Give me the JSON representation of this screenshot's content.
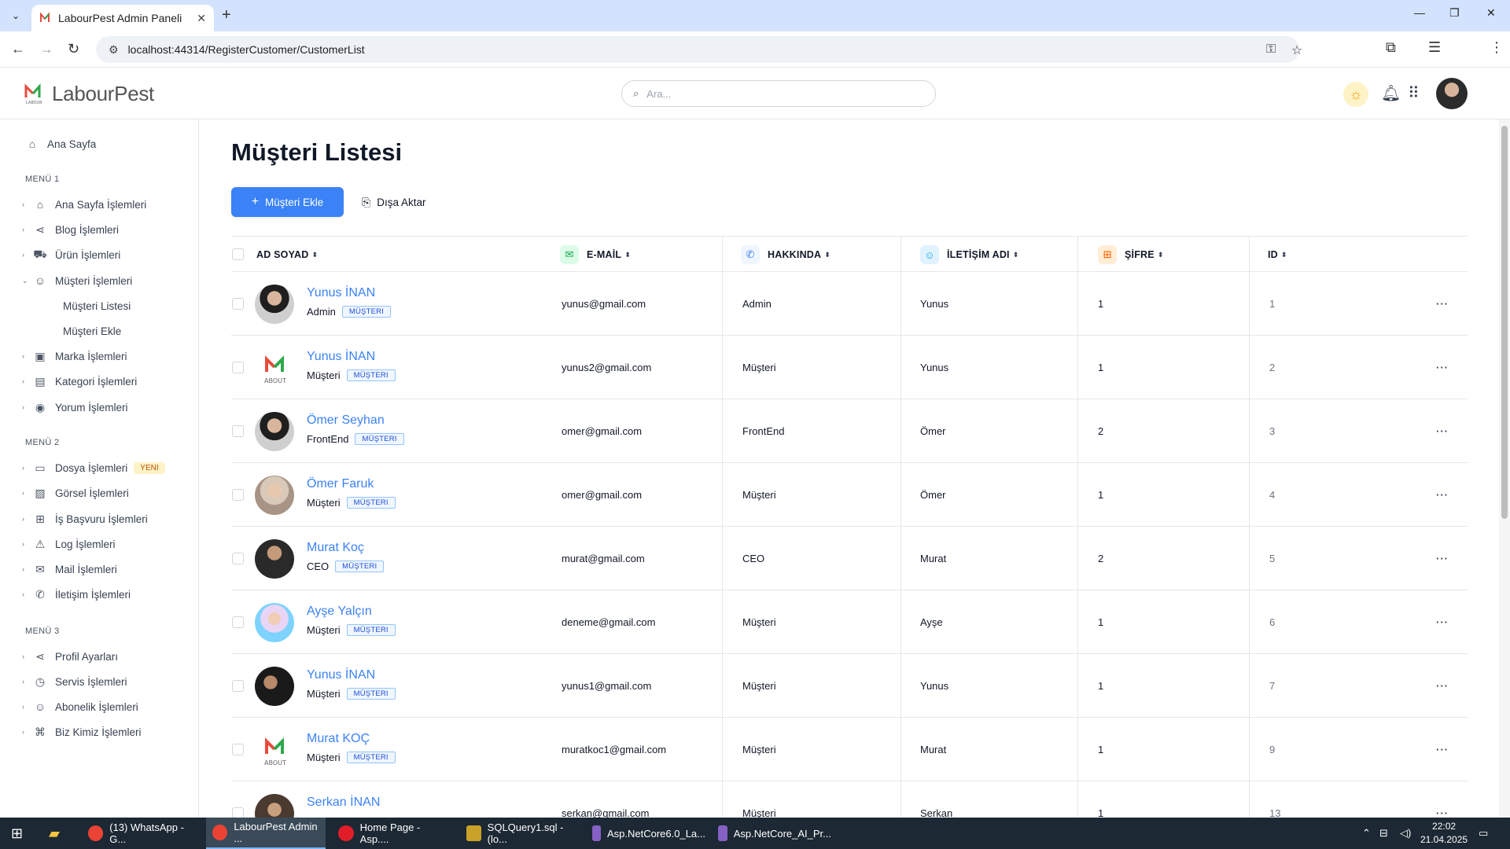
{
  "browser": {
    "tab_title": "LabourPest Admin Paneli",
    "url": "localhost:44314/RegisterCustomer/CustomerList"
  },
  "app": {
    "logo_text": "LabourPest",
    "search_placeholder": "Ara..."
  },
  "sidebar": {
    "home": "Ana Sayfa",
    "menu1_title": "MENÜ 1",
    "menu1": [
      "Ana Sayfa İşlemleri",
      "Blog İşlemleri",
      "Ürün İşlemleri",
      "Müşteri İşlemleri"
    ],
    "menu1_sub": [
      "Müşteri Listesi",
      "Müşteri Ekle"
    ],
    "menu1_rest": [
      "Marka İşlemleri",
      "Kategori İşlemleri",
      "Yorum İşlemleri"
    ],
    "menu2_title": "MENÜ 2",
    "menu2": [
      "Dosya İşlemleri",
      "Görsel İşlemleri",
      "İş Başvuru İşlemleri",
      "Log İşlemleri",
      "Mail İşlemleri",
      "İletişim İşlemleri"
    ],
    "new_badge": "YENI",
    "menu3_title": "MENÜ 3",
    "menu3": [
      "Profil Ayarları",
      "Servis İşlemleri",
      "Abonelik İşlemleri",
      "Biz Kimiz İşlemleri"
    ]
  },
  "main": {
    "title": "Müşteri Listesi",
    "add_button": "Müşteri Ekle",
    "export_button": "Dışa Aktar"
  },
  "table": {
    "headers": [
      "AD SOYAD",
      "E-MAİL",
      "HAKKINDA",
      "İLETİŞİM ADI",
      "ŞİFRE",
      "ID"
    ],
    "tag": "MÜŞTERI",
    "rows": [
      {
        "name": "Yunus İNAN",
        "role": "Admin",
        "email": "yunus@gmail.com",
        "about": "Admin",
        "contact": "Yunus",
        "pass": "1",
        "id": "1",
        "avatar": "man1"
      },
      {
        "name": "Yunus İNAN",
        "role": "Müşteri",
        "email": "yunus2@gmail.com",
        "about": "Müşteri",
        "contact": "Yunus",
        "pass": "1",
        "id": "2",
        "avatar": "logo"
      },
      {
        "name": "Ömer Seyhan",
        "role": "FrontEnd",
        "email": "omer@gmail.com",
        "about": "FrontEnd",
        "contact": "Ömer",
        "pass": "2",
        "id": "3",
        "avatar": "man1"
      },
      {
        "name": "Ömer Faruk",
        "role": "Müşteri",
        "email": "omer@gmail.com",
        "about": "Müşteri",
        "contact": "Ömer",
        "pass": "1",
        "id": "4",
        "avatar": "woman1"
      },
      {
        "name": "Murat Koç",
        "role": "CEO",
        "email": "murat@gmail.com",
        "about": "CEO",
        "contact": "Murat",
        "pass": "2",
        "id": "5",
        "avatar": "man2"
      },
      {
        "name": "Ayşe Yalçın",
        "role": "Müşteri",
        "email": "deneme@gmail.com",
        "about": "Müşteri",
        "contact": "Ayşe",
        "pass": "1",
        "id": "6",
        "avatar": "woman2"
      },
      {
        "name": "Yunus İNAN",
        "role": "Müşteri",
        "email": "yunus1@gmail.com",
        "about": "Müşteri",
        "contact": "Yunus",
        "pass": "1",
        "id": "7",
        "avatar": "man3"
      },
      {
        "name": "Murat KOÇ",
        "role": "Müşteri",
        "email": "muratkoc1@gmail.com",
        "about": "Müşteri",
        "contact": "Murat",
        "pass": "1",
        "id": "9",
        "avatar": "logo"
      },
      {
        "name": "Serkan İNAN",
        "role": "",
        "email": "serkan@gmail.com",
        "about": "Müşteri",
        "contact": "Serkan",
        "pass": "1",
        "id": "13",
        "avatar": "man4"
      }
    ]
  },
  "taskbar": {
    "items": [
      "(13) WhatsApp - G...",
      "LabourPest Admin ...",
      "Home Page - Asp....",
      "SQLQuery1.sql - (lo...",
      "Asp.NetCore6.0_La...",
      "Asp.NetCore_AI_Pr..."
    ],
    "time": "22:02",
    "date": "21.04.2025"
  },
  "colors": {
    "accent": "#3b82f6",
    "tag_text": "#1d4ed8"
  }
}
